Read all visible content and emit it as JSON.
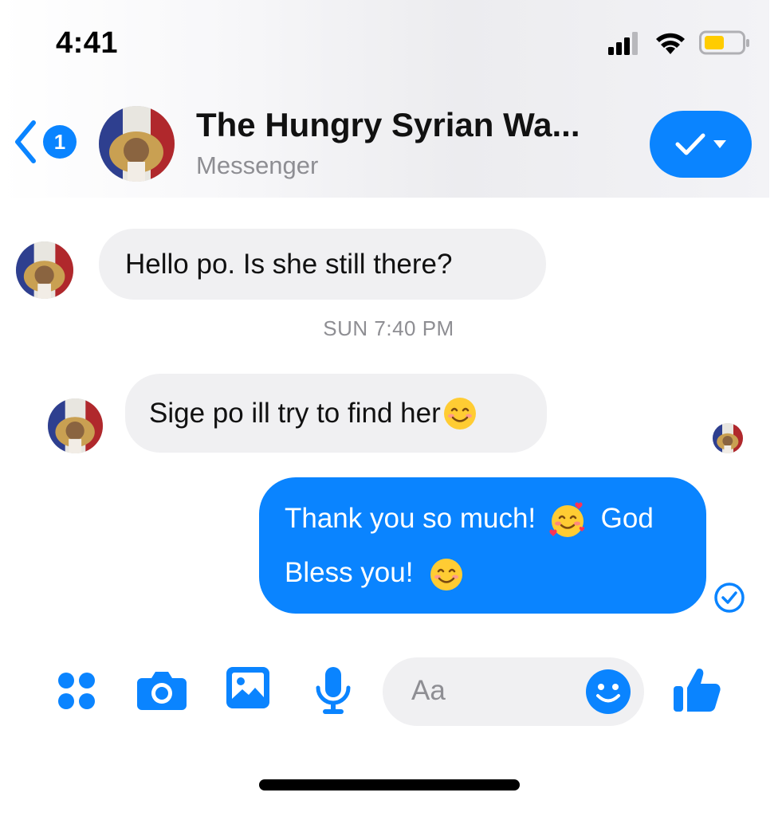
{
  "status_bar": {
    "time": "4:41",
    "signal_icon": "cellular-signal-icon",
    "wifi_icon": "wifi-icon",
    "battery_icon": "battery-low-icon",
    "battery_color": "#ffcc00"
  },
  "header": {
    "back_badge": "1",
    "title": "The Hungry Syrian Wa...",
    "subtitle": "Messenger",
    "action_icon": "checkmark-dropdown-icon",
    "accent": "#0a84ff"
  },
  "messages": [
    {
      "from": "contact",
      "text": "Hello po. Is she still there?"
    },
    {
      "timestamp": "SUN 7:40 PM"
    },
    {
      "from": "contact",
      "text": "Sige po ill try to find her",
      "emoji": "smiling-face-icon"
    },
    {
      "from": "me",
      "line1": "Thank you so much!",
      "emoji1": "smiling-face-with-hearts-icon",
      "line1_end": "God",
      "line2": "Bless you!",
      "emoji2": "smiling-face-icon",
      "status_icon": "delivered-check-icon"
    }
  ],
  "composer": {
    "placeholder": "Aa",
    "tools": [
      "apps-icon",
      "camera-icon",
      "image-icon",
      "microphone-icon"
    ],
    "emoji_button": "emoji-icon",
    "like_button": "thumbs-up-icon"
  }
}
